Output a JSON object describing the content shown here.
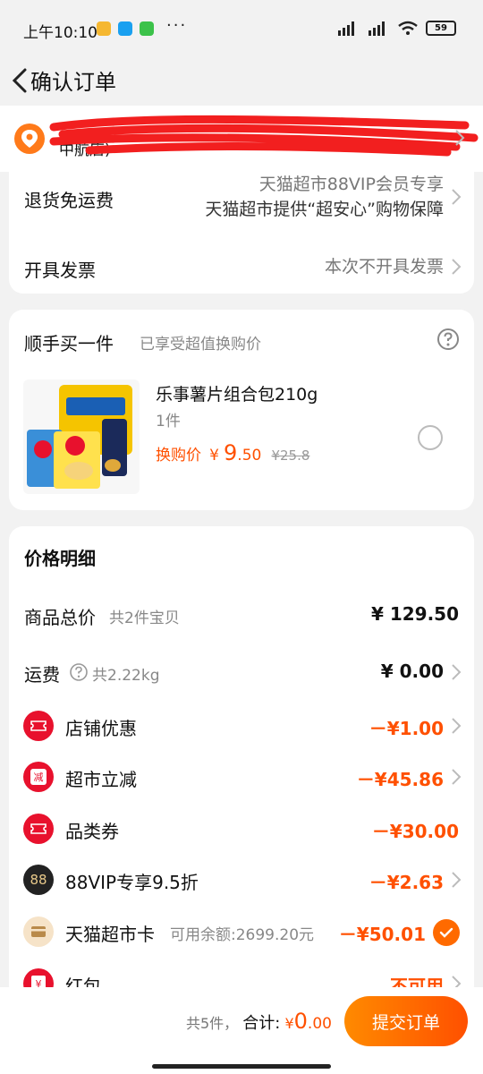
{
  "status": {
    "time": "上午10:10",
    "dots": "···",
    "battery": "59"
  },
  "header": {
    "title": "确认订单"
  },
  "address": {
    "line2": "中航店)"
  },
  "service": {
    "return_label": "退货免运费",
    "return_line1": "天猫超市88VIP会员专享",
    "return_line2": "天猫超市提供“超安心”购物保障",
    "invoice_label": "开具发票",
    "invoice_value": "本次不开具发票"
  },
  "addon": {
    "title": "顺手买一件",
    "subtitle": "已享受超值换购价",
    "product_name": "乐事薯片组合包210g",
    "qty": "1件",
    "price_label": "换购价",
    "currency": "¥",
    "price_int": "9",
    "price_dec": ".50",
    "original_price": "¥25.8"
  },
  "price": {
    "title": "价格明细",
    "goods_label": "商品总价",
    "goods_sub": "共2件宝贝",
    "goods_value": "¥ 129.50",
    "ship_label": "运费",
    "ship_sub": "共2.22kg",
    "ship_value": "¥ 0.00",
    "items": [
      {
        "label": "店铺优惠",
        "value": "－¥1.00"
      },
      {
        "label": "超市立减",
        "value": "－¥45.86"
      },
      {
        "label": "品类券",
        "value": "－¥30.00"
      },
      {
        "label": "88VIP专享9.5折",
        "value": "－¥2.63"
      },
      {
        "label": "天猫超市卡",
        "sub": "可用余额:2699.20元",
        "value": "－¥50.01"
      },
      {
        "label": "红包",
        "value": "不可用"
      }
    ],
    "icon_text": {
      "jian": "减",
      "vip": "88",
      "hongbao": "¥"
    }
  },
  "bottom": {
    "count": "共5件，",
    "total_label": "合计:",
    "currency": "¥",
    "total_int": "0",
    "total_dec": ".00",
    "submit": "提交订单"
  },
  "colors": {
    "accent": "#ff5000",
    "red": "#e8112d",
    "check": "#ff6a00"
  }
}
